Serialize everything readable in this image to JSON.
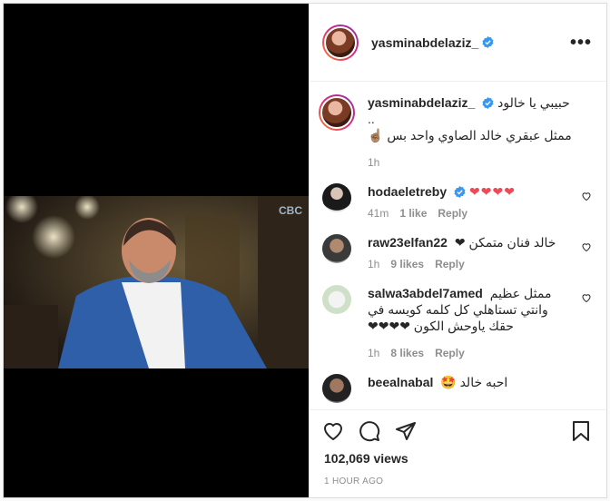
{
  "header": {
    "username": "yasminabdelaziz_",
    "more_label": "•••"
  },
  "video": {
    "channel_logo": "CBC"
  },
  "caption": {
    "username": "yasminabdelaziz_",
    "text_line1": "حبيبي يا خالود ..",
    "text_line2": "ممثل عبقري خالد الصاوي واحد بس ☝🏽",
    "time": "1h"
  },
  "comments": [
    {
      "username": "hodaeletreby",
      "verified": true,
      "text": "❤❤❤❤",
      "time": "41m",
      "likes": "1 like",
      "reply": "Reply"
    },
    {
      "username": "raw23elfan22",
      "verified": false,
      "text": "خالد فنان متمكن ❤",
      "time": "1h",
      "likes": "9 likes",
      "reply": "Reply"
    },
    {
      "username": "salwa3abdel7amed",
      "verified": false,
      "text_line1": "ممثل عظيم",
      "text_line2": "وانتي تستاهلي كل كلمه كويسه في",
      "text_line3": "حقك ياوحش الكون ❤❤❤❤",
      "time": "1h",
      "likes": "8 likes",
      "reply": "Reply"
    },
    {
      "username": "beealnabal",
      "verified": false,
      "text": "احبه خالد 🤩"
    }
  ],
  "stats": {
    "views": "102,069 views",
    "posted": "1 HOUR AGO"
  },
  "colors": {
    "verified_blue": "#3897f0",
    "heart_red": "#ed4956",
    "muted": "#8e8e8e"
  },
  "icons": [
    "more-options-icon",
    "verified-badge-icon",
    "like-icon",
    "comment-icon",
    "share-icon",
    "save-icon",
    "comment-like-icon"
  ]
}
